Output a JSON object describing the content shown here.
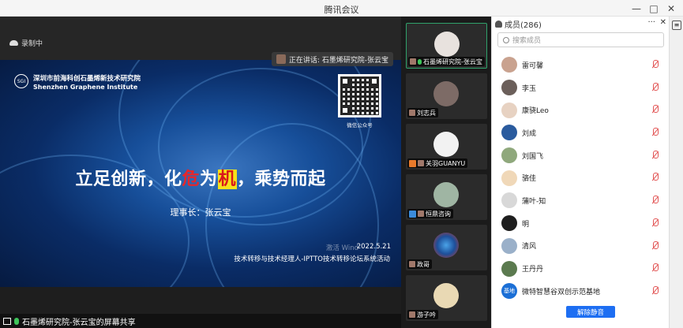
{
  "window": {
    "title": "腾讯会议",
    "minimize": "—",
    "maximize": "□",
    "close": "✕"
  },
  "stage": {
    "recording_label": "录制中",
    "speaking_label": "正在讲话: 石墨烯研究院-张云宝"
  },
  "slide": {
    "logo_text": "SGI",
    "org_cn": "深圳市前海科创石墨烯新技术研究院",
    "org_en": "Shenzhen Graphene Institute",
    "qr_caption": "微信公众号",
    "headline_part1": "立足创新，化",
    "headline_red": "危",
    "headline_part2": "为",
    "headline_hl": "机",
    "headline_part3": "，乘势而起",
    "chair": "理事长：张云宝",
    "watermark": "激活 Wind",
    "date": "2022.5.21",
    "event": "技术转移与技术经理人-IPTTO技术转移论坛系统活动"
  },
  "share_label": "石墨烯研究院-张云宝的屏幕共享",
  "tiles": [
    {
      "name": "石墨烯研究院-张云宝",
      "active": true
    },
    {
      "name": "刘志兵"
    },
    {
      "name": "关羽GUANYU",
      "badge": "orange"
    },
    {
      "name": "恒鼎咨询",
      "badge": "blue"
    },
    {
      "name": "政哥"
    },
    {
      "name": "游子吟"
    }
  ],
  "panel": {
    "title": "成员(286)",
    "more": "···",
    "close": "✕",
    "search_placeholder": "搜索成员",
    "members": [
      {
        "name": "雷可馨"
      },
      {
        "name": "李玉"
      },
      {
        "name": "康骁Leo"
      },
      {
        "name": "刘成"
      },
      {
        "name": "刘国飞"
      },
      {
        "name": "骆佳"
      },
      {
        "name": "蒲叶-知"
      },
      {
        "name": "明"
      },
      {
        "name": "清风"
      },
      {
        "name": "王丹丹"
      },
      {
        "name": "微特智慧谷双创示范基地",
        "avatar_text": "基地"
      }
    ],
    "unmute_all": "解除静音"
  },
  "colors": {
    "accent": "#1d6ef2",
    "active_border": "#2fa26b",
    "muted": "#e25555"
  }
}
